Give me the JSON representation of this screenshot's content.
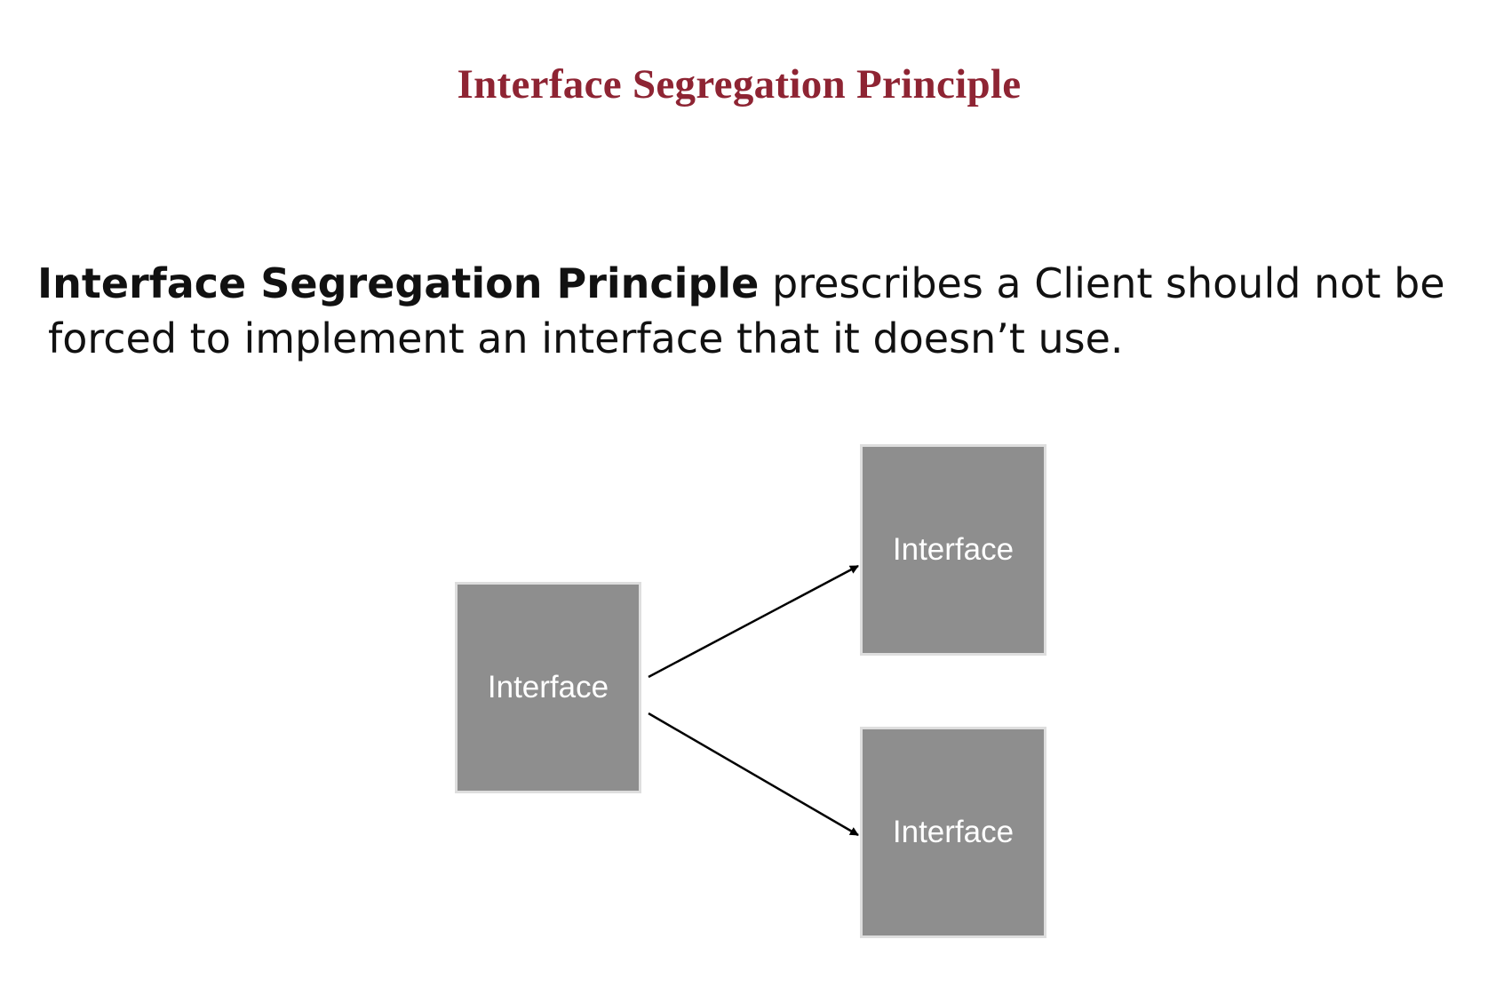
{
  "slide": {
    "title": "Interface Segregation Principle",
    "colors": {
      "title": "#8e2433",
      "box_fill": "#8e8e8e",
      "box_border": "#dedede",
      "box_text": "#ffffff",
      "arrow": "#000000"
    }
  },
  "definition": {
    "term": "Interface Segregation Principle",
    "rest_line1": " prescribes a Client should not be",
    "line2": "forced to implement an interface that it doesn’t use."
  },
  "diagram": {
    "nodes": [
      {
        "id": "source",
        "label": "Interface"
      },
      {
        "id": "target-top",
        "label": "Interface"
      },
      {
        "id": "target-bottom",
        "label": "Interface"
      }
    ],
    "edges": [
      {
        "from": "source",
        "to": "target-top"
      },
      {
        "from": "source",
        "to": "target-bottom"
      }
    ]
  }
}
